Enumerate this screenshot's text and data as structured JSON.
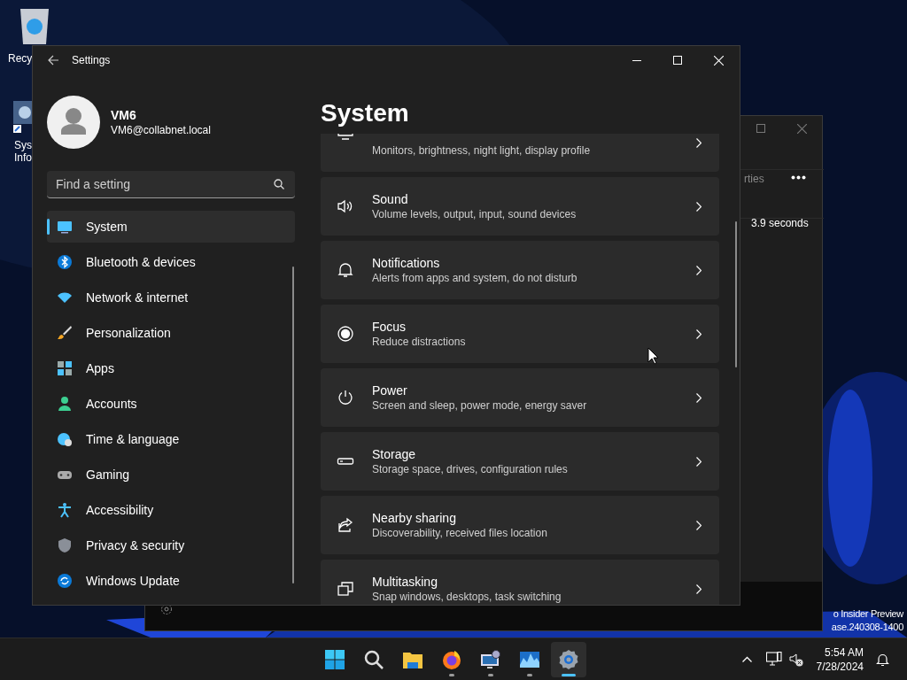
{
  "desktop": {
    "icons": [
      {
        "label": "Recy"
      },
      {
        "label": "Sys\nInfo"
      }
    ],
    "watermark_lines": [
      "o Insider Preview",
      "ase.240308-1400"
    ]
  },
  "back_window": {
    "tab_fragment": "rties",
    "value_text": "3.9 seconds"
  },
  "window": {
    "title": "Settings"
  },
  "profile": {
    "name": "VM6",
    "email": "VM6@collabnet.local"
  },
  "search": {
    "placeholder": "Find a setting"
  },
  "nav": [
    {
      "label": "System",
      "selected": true
    },
    {
      "label": "Bluetooth & devices",
      "selected": false
    },
    {
      "label": "Network & internet",
      "selected": false
    },
    {
      "label": "Personalization",
      "selected": false
    },
    {
      "label": "Apps",
      "selected": false
    },
    {
      "label": "Accounts",
      "selected": false
    },
    {
      "label": "Time & language",
      "selected": false
    },
    {
      "label": "Gaming",
      "selected": false
    },
    {
      "label": "Accessibility",
      "selected": false
    },
    {
      "label": "Privacy & security",
      "selected": false
    },
    {
      "label": "Windows Update",
      "selected": false
    }
  ],
  "page": {
    "title": "System"
  },
  "cards": [
    {
      "kind": "display",
      "description": "Monitors, brightness, night light, display profile"
    },
    {
      "kind": "sound",
      "title": "Sound",
      "description": "Volume levels, output, input, sound devices"
    },
    {
      "kind": "notifications",
      "title": "Notifications",
      "description": "Alerts from apps and system, do not disturb"
    },
    {
      "kind": "focus",
      "title": "Focus",
      "description": "Reduce distractions"
    },
    {
      "kind": "power",
      "title": "Power",
      "description": "Screen and sleep, power mode, energy saver"
    },
    {
      "kind": "storage",
      "title": "Storage",
      "description": "Storage space, drives, configuration rules"
    },
    {
      "kind": "sharing",
      "title": "Nearby sharing",
      "description": "Discoverability, received files location"
    },
    {
      "kind": "multitasking",
      "title": "Multitasking",
      "description": "Snap windows, desktops, task switching"
    }
  ],
  "taskbar": {
    "apps": [
      {
        "kind": "start",
        "running": false,
        "selected": false
      },
      {
        "kind": "search",
        "running": false,
        "selected": false
      },
      {
        "kind": "explorer",
        "running": false,
        "selected": false
      },
      {
        "kind": "firefox",
        "running": true,
        "selected": false
      },
      {
        "kind": "sysinfo",
        "running": true,
        "selected": false
      },
      {
        "kind": "monitor",
        "running": true,
        "selected": false
      },
      {
        "kind": "settings",
        "running": true,
        "selected": true
      }
    ],
    "time": "5:54 AM",
    "date": "7/28/2024"
  }
}
